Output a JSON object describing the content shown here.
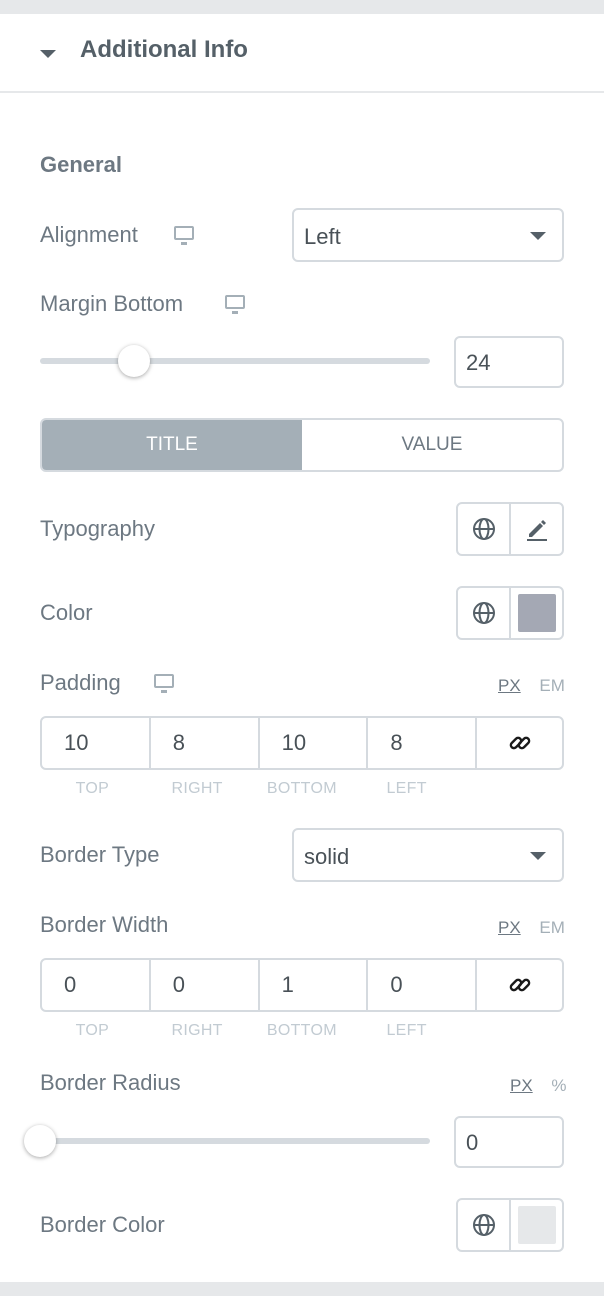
{
  "section": {
    "title": "Additional Info"
  },
  "general": {
    "title": "General"
  },
  "alignment": {
    "label": "Alignment",
    "value": "Left"
  },
  "margin_bottom": {
    "label": "Margin Bottom",
    "value": "24",
    "slider_fraction": 0.24
  },
  "tabs": [
    {
      "label": "TITLE",
      "active": true
    },
    {
      "label": "VALUE",
      "active": false
    }
  ],
  "typography": {
    "label": "Typography"
  },
  "color": {
    "label": "Color",
    "swatch": "#a4a8b4"
  },
  "padding": {
    "label": "Padding",
    "units": [
      "PX",
      "EM"
    ],
    "active_unit": "PX",
    "values": [
      "10",
      "8",
      "10",
      "8"
    ],
    "sides": [
      "TOP",
      "RIGHT",
      "BOTTOM",
      "LEFT"
    ]
  },
  "border_type": {
    "label": "Border Type",
    "value": "solid"
  },
  "border_width": {
    "label": "Border Width",
    "units": [
      "PX",
      "EM"
    ],
    "active_unit": "PX",
    "values": [
      "0",
      "0",
      "1",
      "0"
    ],
    "sides": [
      "TOP",
      "RIGHT",
      "BOTTOM",
      "LEFT"
    ]
  },
  "border_radius": {
    "label": "Border Radius",
    "units": [
      "PX",
      "%"
    ],
    "active_unit": "PX",
    "value": "0",
    "slider_fraction": 0
  },
  "border_color": {
    "label": "Border Color",
    "swatch": "#e6e8ea"
  },
  "colors": {
    "accent": "#a4afb7",
    "text": "#6d7882",
    "border": "#d5dadf"
  }
}
